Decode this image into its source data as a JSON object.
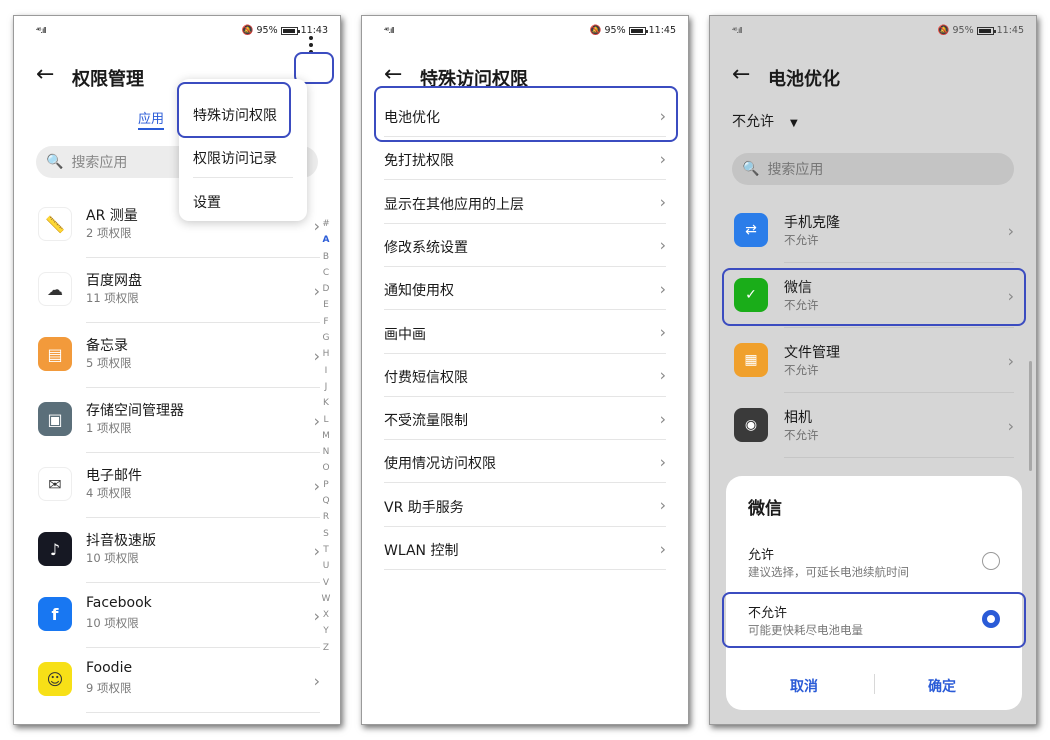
{
  "status": {
    "signal": "⁴⁶.ıll",
    "battery": "95%",
    "time_1": "11:43",
    "time_2": "11:45",
    "time_3": "11:45"
  },
  "screen1": {
    "title": "权限管理",
    "tab_label": "应用",
    "search_placeholder": "搜索应用",
    "menu": [
      "特殊访问权限",
      "权限访问记录",
      "设置"
    ],
    "apps": [
      {
        "name": "AR 测量",
        "sub": "2 项权限",
        "icon": "ar-measure-icon",
        "color": "#ffffff"
      },
      {
        "name": "百度网盘",
        "sub": "11 项权限",
        "icon": "baidu-netdisk-icon",
        "color": "#ffffff"
      },
      {
        "name": "备忘录",
        "sub": "5 项权限",
        "icon": "memo-icon",
        "color": "#f29a3b"
      },
      {
        "name": "存储空间管理器",
        "sub": "1 项权限",
        "icon": "storage-manager-icon",
        "color": "#5b6f7a"
      },
      {
        "name": "电子邮件",
        "sub": "4 项权限",
        "icon": "email-icon",
        "color": "#ffffff"
      },
      {
        "name": "抖音极速版",
        "sub": "10 项权限",
        "icon": "douyin-lite-icon",
        "color": "#161823"
      },
      {
        "name": "Facebook",
        "sub": "10 项权限",
        "icon": "facebook-icon",
        "color": "#1877f2"
      },
      {
        "name": "Foodie",
        "sub": "9 项权限",
        "icon": "foodie-icon",
        "color": "#f7e017"
      }
    ],
    "alphabet": [
      "#",
      "A",
      "B",
      "C",
      "D",
      "E",
      "F",
      "G",
      "H",
      "I",
      "J",
      "K",
      "L",
      "M",
      "N",
      "O",
      "P",
      "Q",
      "R",
      "S",
      "T",
      "U",
      "V",
      "W",
      "X",
      "Y",
      "Z"
    ]
  },
  "screen2": {
    "title": "特殊访问权限",
    "items": [
      "电池优化",
      "免打扰权限",
      "显示在其他应用的上层",
      "修改系统设置",
      "通知使用权",
      "画中画",
      "付费短信权限",
      "不受流量限制",
      "使用情况访问权限",
      "VR 助手服务",
      "WLAN 控制"
    ]
  },
  "screen3": {
    "title": "电池优化",
    "filter_value": "不允许",
    "search_placeholder": "搜索应用",
    "apps": [
      {
        "name": "手机克隆",
        "sub": "不允许",
        "icon": "phone-clone-icon",
        "color": "#2b7de9"
      },
      {
        "name": "微信",
        "sub": "不允许",
        "icon": "wechat-icon",
        "color": "#1aad19"
      },
      {
        "name": "文件管理",
        "sub": "不允许",
        "icon": "file-manager-icon",
        "color": "#f0a02c"
      },
      {
        "name": "相机",
        "sub": "不允许",
        "icon": "camera-icon",
        "color": "#3a3a3a"
      }
    ],
    "dialog": {
      "title": "微信",
      "options": [
        {
          "label": "允许",
          "desc": "建议选择，可延长电池续航时间",
          "selected": false
        },
        {
          "label": "不允许",
          "desc": "可能更快耗尽电池电量",
          "selected": true
        }
      ],
      "cancel": "取消",
      "confirm": "确定"
    }
  },
  "colors": {
    "accent": "#2a5bd7",
    "highlight": "#3b4cc0"
  }
}
